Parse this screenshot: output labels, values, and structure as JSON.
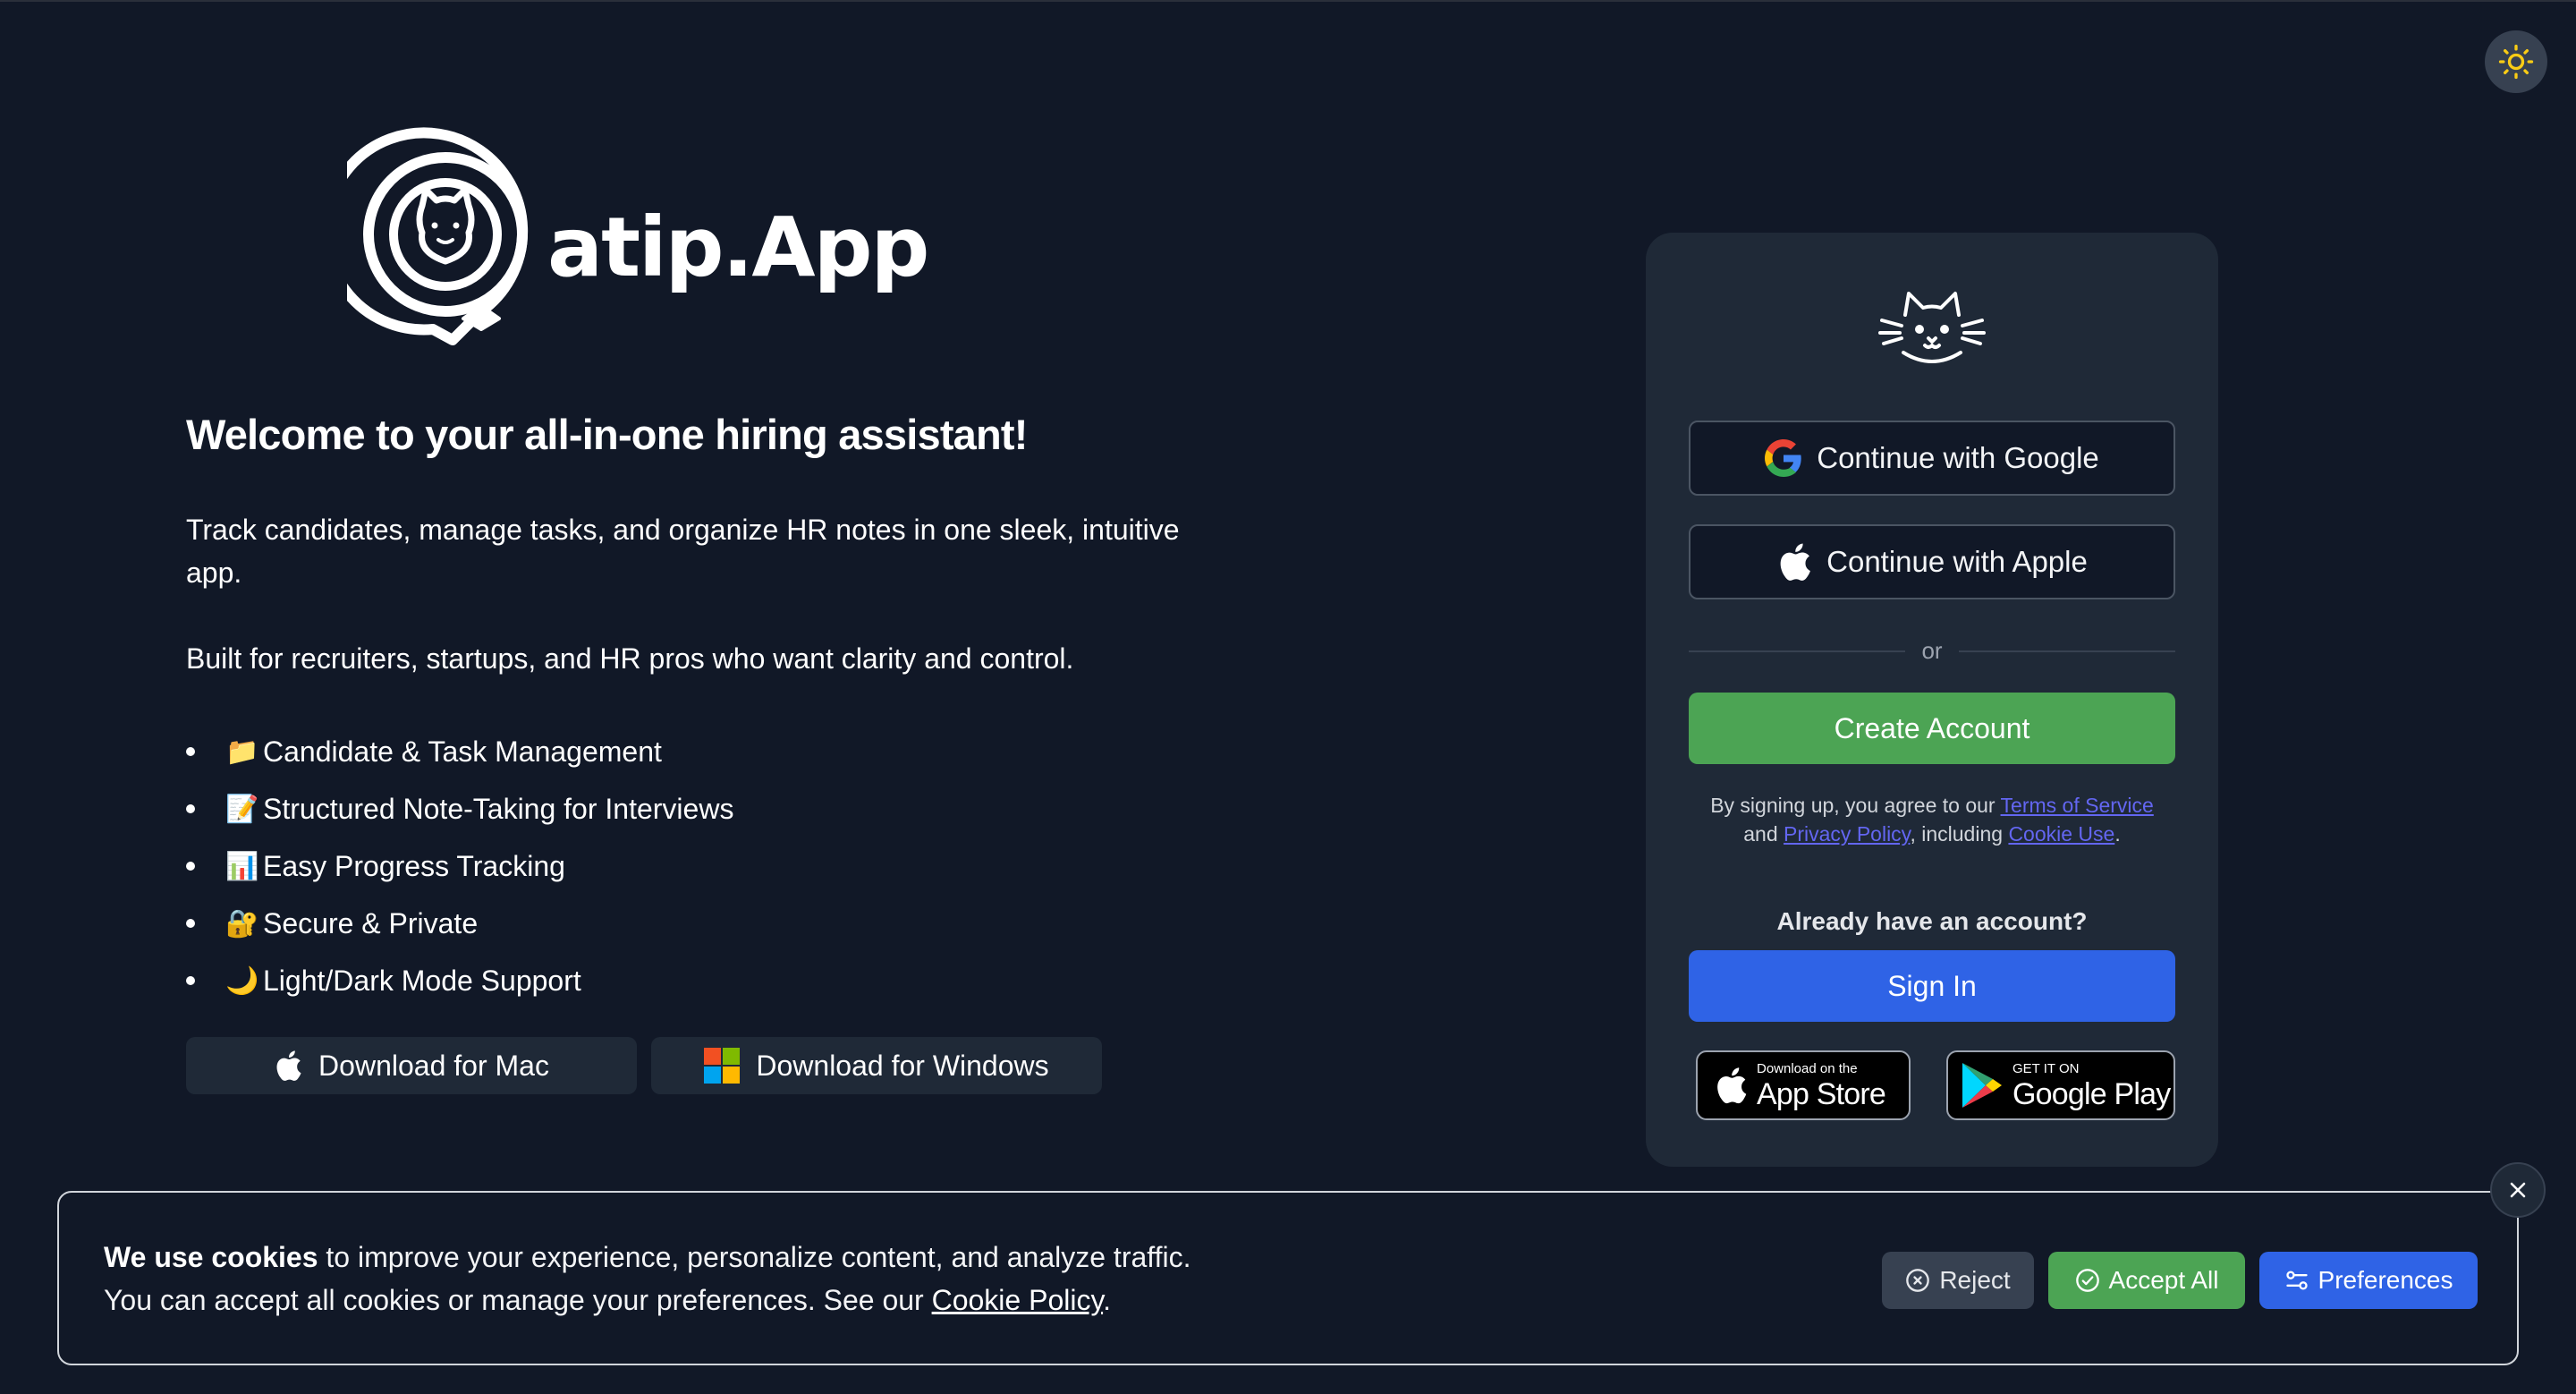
{
  "theme_toggle": {
    "icon": "sun-icon"
  },
  "logo": {
    "text": "atip.App"
  },
  "hero": {
    "title": "Welcome to your all-in-one hiring assistant!",
    "description": "Track candidates, manage tasks, and organize HR notes in one sleek, intuitive app.",
    "audience": "Built for recruiters, startups, and HR pros who want clarity and control."
  },
  "features": [
    {
      "emoji": "📁",
      "label": "Candidate & Task Management"
    },
    {
      "emoji": "📝",
      "label": "Structured Note-Taking for Interviews"
    },
    {
      "emoji": "📊",
      "label": "Easy Progress Tracking"
    },
    {
      "emoji": "🔐",
      "label": "Secure & Private"
    },
    {
      "emoji": "🌙",
      "label": "Light/Dark Mode Support"
    }
  ],
  "downloads": {
    "mac_label": "Download for Mac",
    "windows_label": "Download for Windows"
  },
  "auth": {
    "google_label": "Continue with Google",
    "apple_label": "Continue with Apple",
    "or_label": "or",
    "create_label": "Create Account",
    "terms": {
      "prefix": "By signing up, you agree to our ",
      "tos_link": "Terms of Service",
      "and": " and ",
      "privacy_link": "Privacy Policy",
      "including": ", including ",
      "cookie_link": "Cookie Use",
      "suffix": "."
    },
    "have_account": "Already have an account?",
    "signin_label": "Sign In",
    "appstore": {
      "small": "Download on the",
      "big": "App Store"
    },
    "googleplay": {
      "small": "GET IT ON",
      "big": "Google Play"
    }
  },
  "cookie_banner": {
    "bold": "We use cookies",
    "line1_rest": " to improve your experience, personalize content, and analyze traffic.",
    "line2": "You can accept all cookies or manage your preferences. See our ",
    "policy_link": "Cookie Policy",
    "line2_end": ".",
    "reject_label": "Reject",
    "accept_label": "Accept All",
    "preferences_label": "Preferences"
  },
  "colors": {
    "background": "#111827",
    "card": "#1f2937",
    "green": "#4ca454",
    "blue": "#2f63e6",
    "link": "#6366f1"
  }
}
